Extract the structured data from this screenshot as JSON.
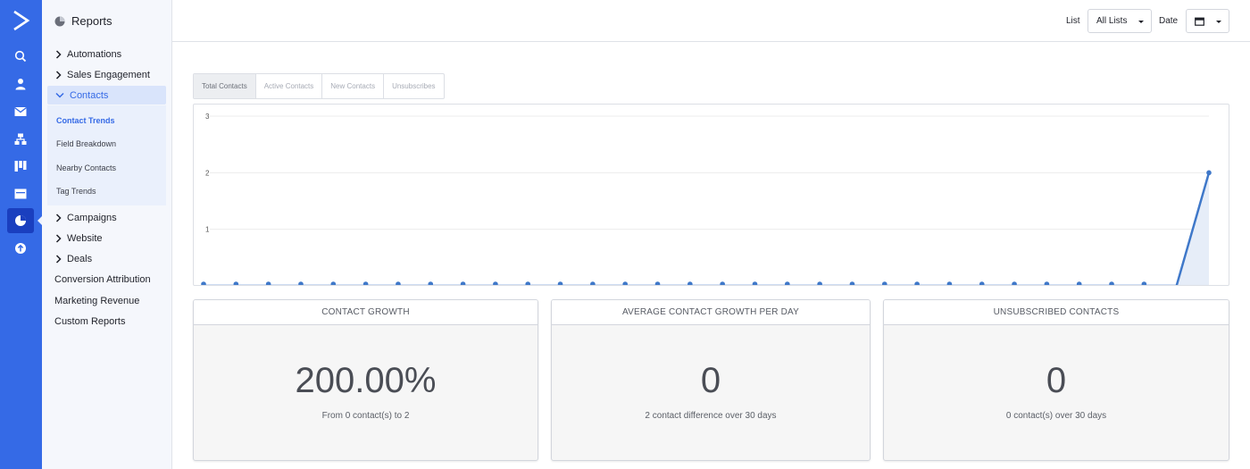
{
  "rail": {
    "icons": [
      "activecampaign-logo-icon",
      "search-icon",
      "contacts-icon",
      "mail-icon",
      "automation-icon",
      "deals-icon",
      "site-icon",
      "reports-icon",
      "add-circle-icon"
    ]
  },
  "sidebar": {
    "title": "Reports",
    "groups": [
      {
        "label": "Automations"
      },
      {
        "label": "Sales Engagement"
      },
      {
        "label": "Contacts"
      }
    ],
    "contacts_items": [
      "Contact Trends",
      "Field Breakdown",
      "Nearby Contacts",
      "Tag Trends"
    ],
    "more_groups": [
      {
        "label": "Campaigns"
      },
      {
        "label": "Website"
      },
      {
        "label": "Deals"
      }
    ],
    "links": [
      "Conversion Attribution",
      "Marketing Revenue",
      "Custom Reports"
    ]
  },
  "topbar": {
    "list_label": "List",
    "list_value": "All Lists",
    "date_label": "Date"
  },
  "tabs": [
    "Total Contacts",
    "Active Contacts",
    "New Contacts",
    "Unsubscribes"
  ],
  "chart_data": {
    "type": "area",
    "ylim": [
      0,
      3
    ],
    "yticks": [
      "3",
      "2",
      "1"
    ],
    "x": [
      1,
      2,
      3,
      4,
      5,
      6,
      7,
      8,
      9,
      10,
      11,
      12,
      13,
      14,
      15,
      16,
      17,
      18,
      19,
      20,
      21,
      22,
      23,
      24,
      25,
      26,
      27,
      28,
      29,
      30,
      31,
      32
    ],
    "series": [
      {
        "values": [
          0,
          0,
          0,
          0,
          0,
          0,
          0,
          0,
          0,
          0,
          0,
          0,
          0,
          0,
          0,
          0,
          0,
          0,
          0,
          0,
          0,
          0,
          0,
          0,
          0,
          0,
          0,
          0,
          0,
          0,
          0,
          2
        ]
      }
    ],
    "grid": true,
    "color": "#3f78c9"
  },
  "cards": [
    {
      "title": "CONTACT GROWTH",
      "value": "200.00%",
      "caption": "From 0 contact(s) to 2"
    },
    {
      "title": "AVERAGE CONTACT GROWTH PER DAY",
      "value": "0",
      "caption": "2 contact difference over 30 days"
    },
    {
      "title": "UNSUBSCRIBED CONTACTS",
      "value": "0",
      "caption": "0 contact(s) over 30 days"
    }
  ],
  "colors": {
    "rail": "#356ae6",
    "accent": "#356ae6"
  }
}
